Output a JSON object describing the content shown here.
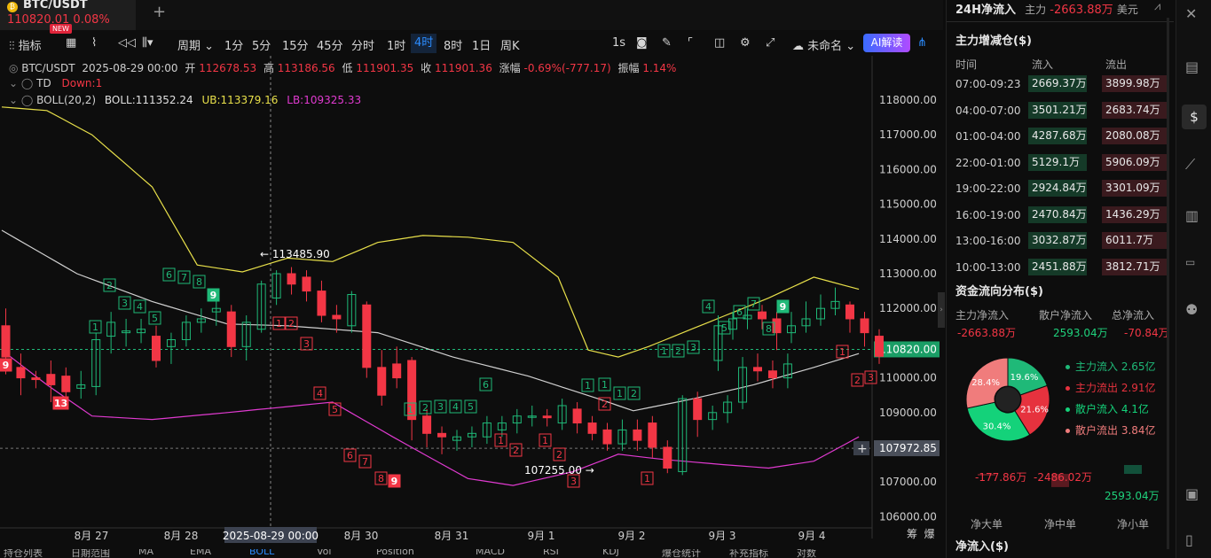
{
  "tab": {
    "symbol": "BTC/USDT",
    "price_change": "110820.01 0.08%",
    "coin": "₿"
  },
  "new_badge": "NEW",
  "toolbar": {
    "indicators": "指标",
    "period": "周期",
    "intervals": [
      "1分",
      "5分",
      "15分",
      "45分",
      "分时",
      "1时",
      "4时",
      "8时",
      "1日",
      "周K"
    ],
    "active_interval": "4时",
    "right_1s": "1s",
    "layout_name": "未命名",
    "ai_label": "AI解读"
  },
  "ohlc": {
    "symbol": "BTC/USDT",
    "date": "2025-08-29 00:00",
    "open_label": "开",
    "open": "112678.53",
    "high_label": "高",
    "high": "113186.56",
    "low_label": "低",
    "low": "111901.35",
    "close_label": "收",
    "close": "111901.36",
    "chg_label": "涨幅",
    "chg": "-0.69%(-777.17)",
    "amp_label": "振幅",
    "amp": "1.14%"
  },
  "td": {
    "name": "TD",
    "value": "Down:1"
  },
  "boll": {
    "name": "BOLL(20,2)",
    "mid": "BOLL:111352.24",
    "ub": "UB:113379.16",
    "lb": "LB:109325.33"
  },
  "price_axis": [
    "118000.00",
    "117000.00",
    "116000.00",
    "115000.00",
    "114000.00",
    "113000.00",
    "112000.00",
    "110820.00",
    "110000.00",
    "109000.00",
    "107972.85",
    "107000.00",
    "106000.00"
  ],
  "x_axis": [
    "8月 27",
    "8月 28",
    "2025-08-29 00:00",
    "8月 30",
    "8月 31",
    "9月 1",
    "9月 2",
    "9月 3",
    "9月 4"
  ],
  "annotations": {
    "high": "← 113485.90",
    "low": "107255.00 →"
  },
  "axis_corner": [
    "筹",
    "爆"
  ],
  "bottom_tabs": [
    "持仓列表",
    "日期范围",
    "MA",
    "EMA",
    "BOLL",
    "Vol",
    "Position",
    "MACD",
    "RSI",
    "KDJ",
    "爆仓统计",
    "补充指标",
    "对数"
  ],
  "right_panel": {
    "header_title": "24H净流入",
    "header_sub": "主力",
    "header_value": "-2663.88万",
    "header_unit": "美元",
    "section1_title": "主力增减仓($)",
    "cols": [
      "时间",
      "流入",
      "流出"
    ],
    "rows": [
      {
        "time": "07:00-09:23",
        "in": "2669.37万",
        "out": "3899.98万"
      },
      {
        "time": "04:00-07:00",
        "in": "3501.21万",
        "out": "2683.74万"
      },
      {
        "time": "01:00-04:00",
        "in": "4287.68万",
        "out": "2080.08万"
      },
      {
        "time": "22:00-01:00",
        "in": "5129.1万",
        "out": "5906.09万"
      },
      {
        "time": "19:00-22:00",
        "in": "2924.84万",
        "out": "3301.09万"
      },
      {
        "time": "16:00-19:00",
        "in": "2470.84万",
        "out": "1436.29万"
      },
      {
        "time": "13:00-16:00",
        "in": "3032.87万",
        "out": "6011.7万"
      },
      {
        "time": "10:00-13:00",
        "in": "2451.88万",
        "out": "3812.71万"
      }
    ],
    "section2_title": "资金流向分布($)",
    "dist_labels": [
      "主力净流入",
      "散户净流入",
      "总净流入"
    ],
    "dist_values": [
      "-2663.88万",
      "2593.04万",
      "-70.84万"
    ],
    "pie": [
      {
        "label": "主力流入",
        "value": "2.65亿",
        "pct": "19.6%",
        "color": "#1fb978"
      },
      {
        "label": "主力流出",
        "value": "2.91亿",
        "pct": "21.6%",
        "color": "#e6323e"
      },
      {
        "label": "散户流入",
        "value": "4.1亿",
        "pct": "30.4%",
        "color": "#14d27a"
      },
      {
        "label": "散户流出",
        "value": "3.84亿",
        "pct": "28.4%",
        "color": "#f07c7c"
      }
    ],
    "bars": [
      {
        "label": "净大单",
        "value": "-177.86万"
      },
      {
        "label": "净中单",
        "value": "-2486.02万"
      },
      {
        "label": "净小单",
        "value": "2593.04万"
      }
    ],
    "net_title": "净流入($)"
  }
}
